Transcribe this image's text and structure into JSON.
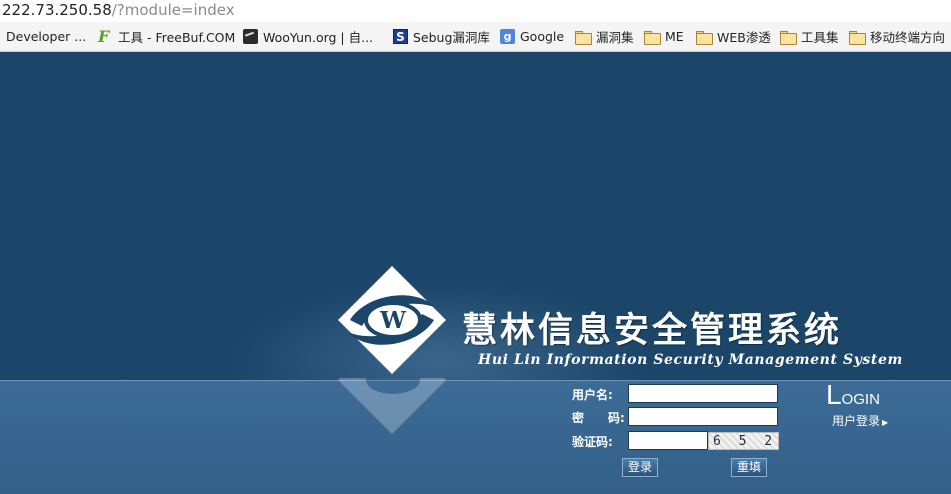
{
  "browser": {
    "url_host": "222.73.250.58",
    "url_path": "/?module=index"
  },
  "bookmarks": [
    {
      "label": "Developer ...",
      "icon": "none"
    },
    {
      "label": "工具 - FreeBuf.COM",
      "icon": "freebuf-icon"
    },
    {
      "label": "WooYun.org | 自...",
      "icon": "wooyun-icon"
    },
    {
      "label": "Sebug漏洞库",
      "icon": "sebug-icon"
    },
    {
      "label": "Google",
      "icon": "google-icon"
    },
    {
      "label": "漏洞集",
      "icon": "folder-icon"
    },
    {
      "label": "ME",
      "icon": "folder-icon"
    },
    {
      "label": "WEB渗透",
      "icon": "folder-icon"
    },
    {
      "label": "工具集",
      "icon": "folder-icon"
    },
    {
      "label": "移动终端方向",
      "icon": "folder-icon"
    }
  ],
  "bookmark_icon_glyphs": {
    "freebuf": "F",
    "sebug": "S",
    "google": "g"
  },
  "brand": {
    "title_cn": "慧林信息安全管理系统",
    "title_en": "Hui Lin Information Security Management System",
    "logo_letter": "W"
  },
  "login": {
    "username_label": "用户名:",
    "username_value": "",
    "password_label_left": "密",
    "password_label_right": "码:",
    "password_value": "",
    "captcha_label": "验证码:",
    "captcha_value": "",
    "captcha_text": "6 5 2 2",
    "login_button": "登录",
    "reset_button": "重填",
    "login_title_first": "L",
    "login_title_rest": "OGIN",
    "login_subtitle": "用户登录",
    "login_arrow": "▶"
  },
  "colors": {
    "page_bg": "#1b4569",
    "band_bg": "#3c6c97",
    "text": "#ffffff"
  }
}
